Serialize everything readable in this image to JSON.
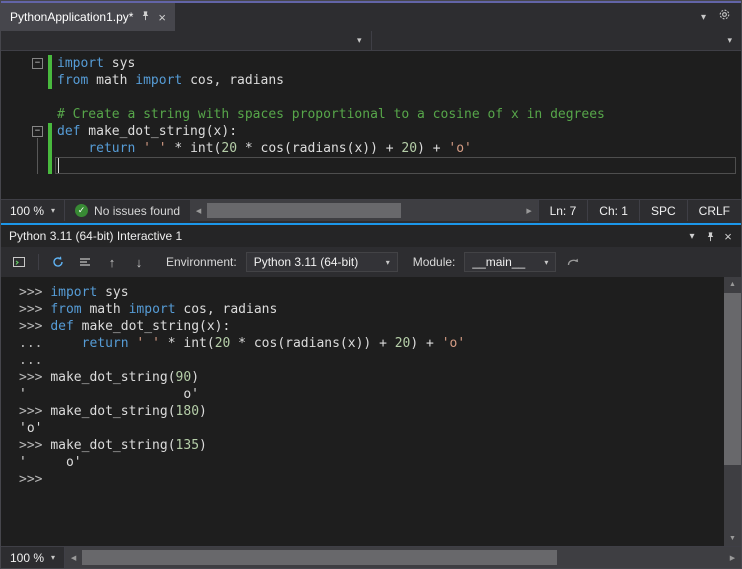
{
  "colors": {
    "accent_top": "#6264a7",
    "accent_interactive": "#1c97ea",
    "keyword": "#569cd6",
    "string": "#d69d85",
    "comment": "#57a64a",
    "number": "#b5cea8",
    "default": "#dcdcdc",
    "prompt": "#b8b8b8",
    "change_bar": "#49b93e"
  },
  "icons": {
    "close": "×",
    "chevron_down": "▾",
    "collapse": "−",
    "check": "✓",
    "arrow_up": "↑",
    "arrow_down": "↓",
    "scroll_left": "◀",
    "scroll_right": "▶",
    "scroll_up": "▲",
    "scroll_down": "▼"
  },
  "editor": {
    "tab_title": "PythonApplication1.py*",
    "code_lines": [
      [
        [
          "k",
          "import"
        ],
        [
          "d",
          " sys"
        ]
      ],
      [
        [
          "k",
          "from"
        ],
        [
          "d",
          " math "
        ],
        [
          "k",
          "import"
        ],
        [
          "d",
          " cos, radians"
        ]
      ],
      [],
      [
        [
          "c",
          "# Create a string with spaces proportional to a cosine of x in degrees"
        ]
      ],
      [
        [
          "k",
          "def"
        ],
        [
          "d",
          " make_dot_string(x):"
        ]
      ],
      [
        [
          "d",
          "    "
        ],
        [
          "k",
          "return"
        ],
        [
          "d",
          " "
        ],
        [
          "s",
          "' '"
        ],
        [
          "d",
          " * int("
        ],
        [
          "n",
          "20"
        ],
        [
          "d",
          " * cos(radians(x)) + "
        ],
        [
          "n",
          "20"
        ],
        [
          "d",
          ") + "
        ],
        [
          "s",
          "'o'"
        ]
      ],
      []
    ],
    "status": {
      "zoom": "100 %",
      "health": "No issues found",
      "line": "Ln: 7",
      "column": "Ch: 1",
      "spaces": "SPC",
      "line_ending": "CRLF"
    }
  },
  "interactive": {
    "title": "Python 3.11 (64-bit) Interactive 1",
    "toolbar": {
      "environment_label": "Environment:",
      "environment_value": "Python 3.11 (64-bit)",
      "module_label": "Module:",
      "module_value": "__main__"
    },
    "repl_lines": [
      [
        [
          "p",
          ">>> "
        ],
        [
          "k",
          "import"
        ],
        [
          "d",
          " sys"
        ]
      ],
      [
        [
          "p",
          ">>> "
        ],
        [
          "k",
          "from"
        ],
        [
          "d",
          " math "
        ],
        [
          "k",
          "import"
        ],
        [
          "d",
          " cos, radians"
        ]
      ],
      [
        [
          "p",
          ">>> "
        ],
        [
          "k",
          "def"
        ],
        [
          "d",
          " make_dot_string(x):"
        ]
      ],
      [
        [
          "p",
          "... "
        ],
        [
          "d",
          "    "
        ],
        [
          "k",
          "return"
        ],
        [
          "d",
          " "
        ],
        [
          "s",
          "' '"
        ],
        [
          "d",
          " * int("
        ],
        [
          "n",
          "20"
        ],
        [
          "d",
          " * cos(radians(x)) + "
        ],
        [
          "n",
          "20"
        ],
        [
          "d",
          ") + "
        ],
        [
          "s",
          "'o'"
        ]
      ],
      [
        [
          "p",
          "..."
        ]
      ],
      [
        [
          "p",
          ">>> "
        ],
        [
          "d",
          "make_dot_string("
        ],
        [
          "n",
          "90"
        ],
        [
          "d",
          ")"
        ]
      ],
      [
        [
          "d",
          "'                    o'"
        ]
      ],
      [
        [
          "p",
          ">>> "
        ],
        [
          "d",
          "make_dot_string("
        ],
        [
          "n",
          "180"
        ],
        [
          "d",
          ")"
        ]
      ],
      [
        [
          "d",
          "'o'"
        ]
      ],
      [
        [
          "p",
          ">>> "
        ],
        [
          "d",
          "make_dot_string("
        ],
        [
          "n",
          "135"
        ],
        [
          "d",
          ")"
        ]
      ],
      [
        [
          "d",
          "'     o'"
        ]
      ],
      [
        [
          "p",
          ">>> "
        ]
      ]
    ],
    "zoom": "100 %"
  }
}
